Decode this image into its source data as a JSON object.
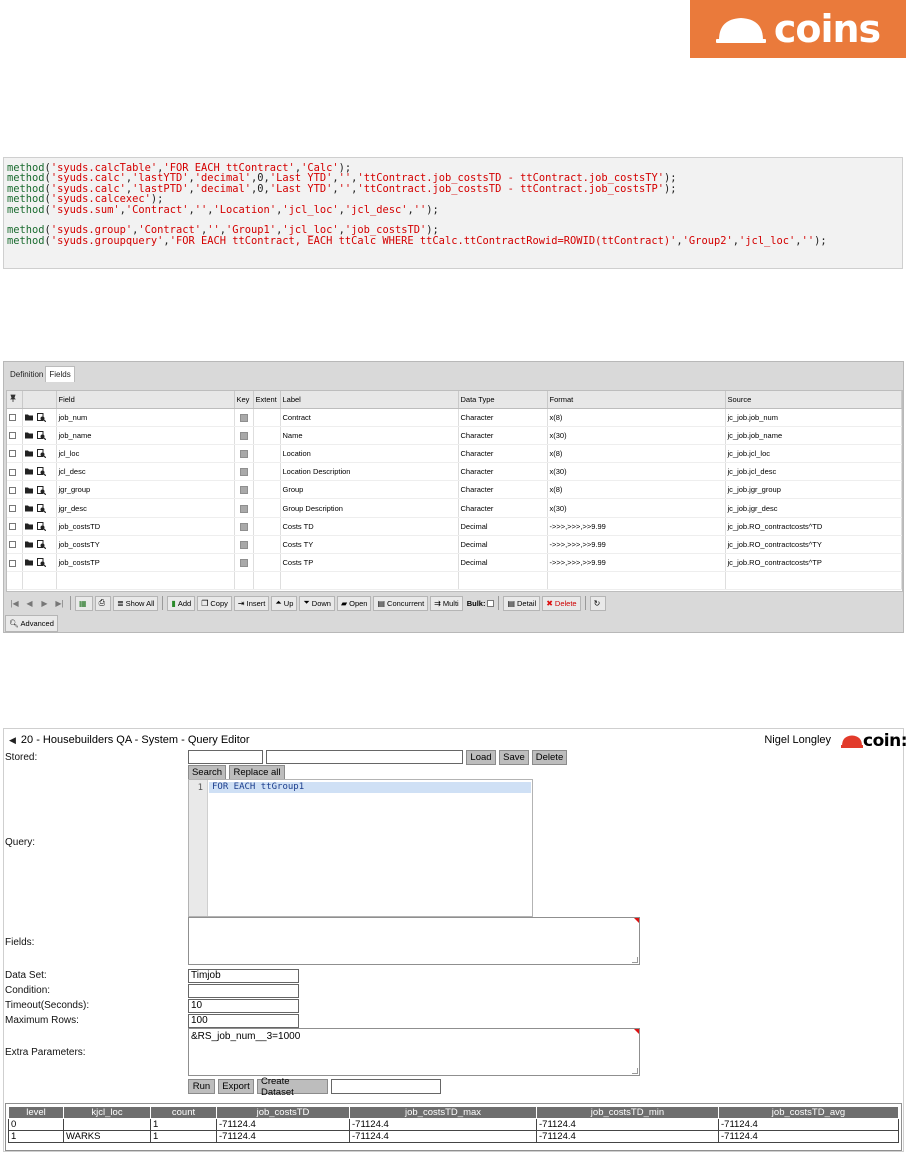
{
  "brand": {
    "logo_text": "coins",
    "accent": "#ea7a3b"
  },
  "code": {
    "lines": [
      [
        [
          "kw",
          "method"
        ],
        [
          "pn",
          "("
        ],
        [
          "st",
          "'syuds.calcTable'"
        ],
        [
          "pn",
          ","
        ],
        [
          "st",
          "'FOR EACH ttContract'"
        ],
        [
          "pn",
          ","
        ],
        [
          "st",
          "'Calc'"
        ],
        [
          "pn",
          ");"
        ]
      ],
      [
        [
          "kw",
          "method"
        ],
        [
          "pn",
          "("
        ],
        [
          "st",
          "'syuds.calc'"
        ],
        [
          "pn",
          ","
        ],
        [
          "st",
          "'lastYTD'"
        ],
        [
          "pn",
          ","
        ],
        [
          "st",
          "'decimal'"
        ],
        [
          "pn",
          ",0,"
        ],
        [
          "st",
          "'Last YTD'"
        ],
        [
          "pn",
          ","
        ],
        [
          "st",
          "''"
        ],
        [
          "pn",
          ","
        ],
        [
          "st",
          "'ttContract.job_costsTD - ttContract.job_costsTY'"
        ],
        [
          "pn",
          ");"
        ]
      ],
      [
        [
          "kw",
          "method"
        ],
        [
          "pn",
          "("
        ],
        [
          "st",
          "'syuds.calc'"
        ],
        [
          "pn",
          ","
        ],
        [
          "st",
          "'lastPTD'"
        ],
        [
          "pn",
          ","
        ],
        [
          "st",
          "'decimal'"
        ],
        [
          "pn",
          ",0,"
        ],
        [
          "st",
          "'Last YTD'"
        ],
        [
          "pn",
          ","
        ],
        [
          "st",
          "''"
        ],
        [
          "pn",
          ","
        ],
        [
          "st",
          "'ttContract.job_costsTD - ttContract.job_costsTP'"
        ],
        [
          "pn",
          ");"
        ]
      ],
      [
        [
          "kw",
          "method"
        ],
        [
          "pn",
          "("
        ],
        [
          "st",
          "'syuds.calcexec'"
        ],
        [
          "pn",
          ");"
        ]
      ],
      [
        [
          "kw",
          "method"
        ],
        [
          "pn",
          "("
        ],
        [
          "st",
          "'syuds.sum'"
        ],
        [
          "pn",
          ","
        ],
        [
          "st",
          "'Contract'"
        ],
        [
          "pn",
          ","
        ],
        [
          "st",
          "''"
        ],
        [
          "pn",
          ","
        ],
        [
          "st",
          "'Location'"
        ],
        [
          "pn",
          ","
        ],
        [
          "st",
          "'jcl_loc'"
        ],
        [
          "pn",
          ","
        ],
        [
          "st",
          "'jcl_desc'"
        ],
        [
          "pn",
          ","
        ],
        [
          "st",
          "''"
        ],
        [
          "pn",
          ");"
        ]
      ],
      [],
      [
        [
          "kw",
          "method"
        ],
        [
          "pn",
          "("
        ],
        [
          "st",
          "'syuds.group'"
        ],
        [
          "pn",
          ","
        ],
        [
          "st",
          "'Contract'"
        ],
        [
          "pn",
          ","
        ],
        [
          "st",
          "''"
        ],
        [
          "pn",
          ","
        ],
        [
          "st",
          "'Group1'"
        ],
        [
          "pn",
          ","
        ],
        [
          "st",
          "'jcl_loc'"
        ],
        [
          "pn",
          ","
        ],
        [
          "st",
          "'job_costsTD'"
        ],
        [
          "pn",
          ");"
        ]
      ],
      [
        [
          "kw",
          "method"
        ],
        [
          "pn",
          "("
        ],
        [
          "st",
          "'syuds.groupquery'"
        ],
        [
          "pn",
          ","
        ],
        [
          "st",
          "'FOR EACH ttContract, EACH ttCalc WHERE ttCalc.ttContractRowid=ROWID(ttContract)'"
        ],
        [
          "pn",
          ","
        ],
        [
          "st",
          "'Group2'"
        ],
        [
          "pn",
          ","
        ],
        [
          "st",
          "'jcl_loc'"
        ],
        [
          "pn",
          ","
        ],
        [
          "st",
          "''"
        ],
        [
          "pn",
          ");"
        ]
      ]
    ]
  },
  "fields_panel": {
    "tabs": [
      "Definition",
      "Fields"
    ],
    "columns": [
      "",
      "",
      "Field",
      "Key",
      "Extent",
      "Label",
      "Data Type",
      "Format",
      "Source"
    ],
    "rows": [
      {
        "field": "job_num",
        "label": "Contract",
        "type": "Character",
        "format": "x(8)",
        "source": "jc_job.job_num"
      },
      {
        "field": "job_name",
        "label": "Name",
        "type": "Character",
        "format": "x(30)",
        "source": "jc_job.job_name"
      },
      {
        "field": "jcl_loc",
        "label": "Location",
        "type": "Character",
        "format": "x(8)",
        "source": "jc_job.jcl_loc"
      },
      {
        "field": "jcl_desc",
        "label": "Location Description",
        "type": "Character",
        "format": "x(30)",
        "source": "jc_job.jcl_desc"
      },
      {
        "field": "jgr_group",
        "label": "Group",
        "type": "Character",
        "format": "x(8)",
        "source": "jc_job.jgr_group"
      },
      {
        "field": "jgr_desc",
        "label": "Group Description",
        "type": "Character",
        "format": "x(30)",
        "source": "jc_job.jgr_desc"
      },
      {
        "field": "job_costsTD",
        "label": "Costs TD",
        "type": "Decimal",
        "format": "->>>,>>>,>>9.99",
        "source": "jc_job.RO_contractcosts^TD"
      },
      {
        "field": "job_costsTY",
        "label": "Costs TY",
        "type": "Decimal",
        "format": "->>>,>>>,>>9.99",
        "source": "jc_job.RO_contractcosts^TY"
      },
      {
        "field": "job_costsTP",
        "label": "Costs TP",
        "type": "Decimal",
        "format": "->>>,>>>,>>9.99",
        "source": "jc_job.RO_contractcosts^TP"
      }
    ],
    "toolbar": {
      "show_all": "Show All",
      "add": "Add",
      "copy": "Copy",
      "insert": "Insert",
      "up": "Up",
      "down": "Down",
      "open": "Open",
      "concurrent": "Concurrent",
      "multi": "Multi",
      "bulk": "Bulk:",
      "detail": "Detail",
      "delete": "Delete"
    },
    "advanced": "Advanced"
  },
  "query_editor": {
    "title": "20 - Housebuilders QA - System - Query Editor",
    "user": "Nigel Longley",
    "logo_text": "coin:",
    "stored_label": "Stored:",
    "load": "Load",
    "save": "Save",
    "delete": "Delete",
    "search": "Search",
    "replace_all": "Replace all",
    "query_label": "Query:",
    "editor_line_no": "1",
    "editor_text": "FOR EACH ttGroup1",
    "fields_label": "Fields:",
    "dataset_label": "Data Set:",
    "dataset_value": "Timjob",
    "condition_label": "Condition:",
    "timeout_label": "Timeout(Seconds):",
    "timeout_value": "10",
    "maxrows_label": "Maximum Rows:",
    "maxrows_value": "100",
    "extra_label": "Extra Parameters:",
    "extra_value": "&RS_job_num__3=1000",
    "run": "Run",
    "export": "Export",
    "create_dataset": "Create Dataset",
    "results": {
      "columns": [
        "level",
        "kjcl_loc",
        "count",
        "job_costsTD",
        "job_costsTD_max",
        "job_costsTD_min",
        "job_costsTD_avg"
      ],
      "rows": [
        [
          "0",
          "",
          "1",
          "-71124.4",
          "-71124.4",
          "-71124.4",
          "-71124.4"
        ],
        [
          "1",
          "WARKS",
          "1",
          "-71124.4",
          "-71124.4",
          "-71124.4",
          "-71124.4"
        ]
      ]
    }
  }
}
